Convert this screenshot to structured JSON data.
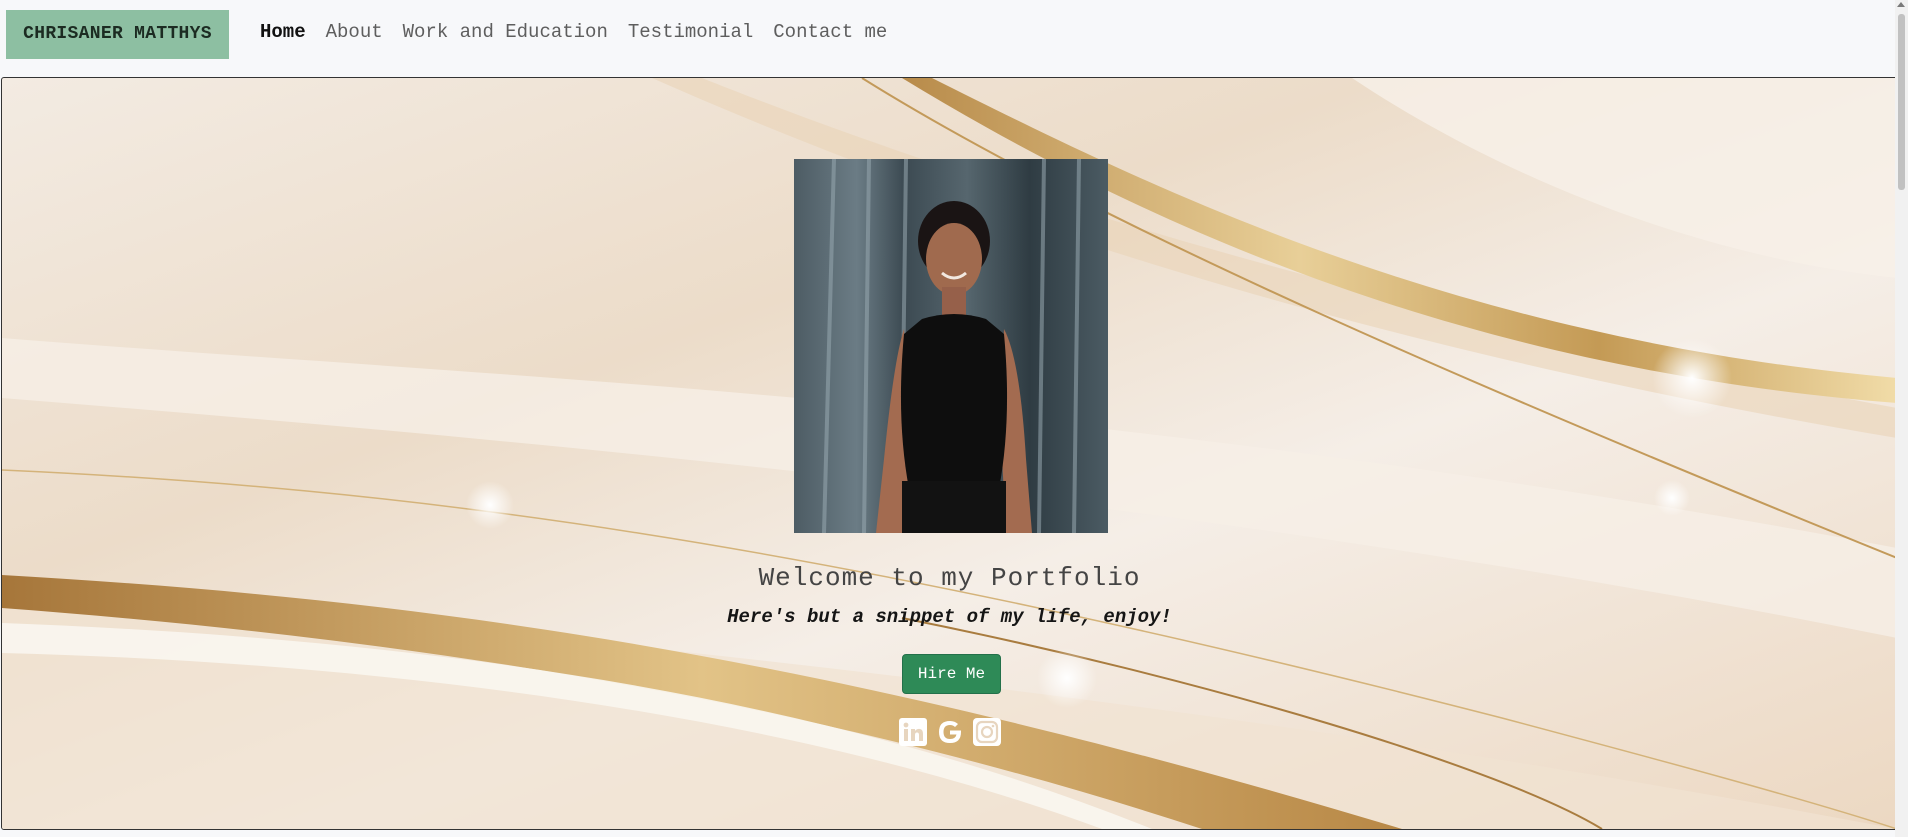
{
  "navbar": {
    "brand": "CHRISANER MATTHYS",
    "links": [
      {
        "label": "Home",
        "active": true
      },
      {
        "label": "About"
      },
      {
        "label": "Work and Education"
      },
      {
        "label": "Testimonial"
      },
      {
        "label": "Contact me"
      }
    ]
  },
  "hero": {
    "welcome": "Welcome to my Portfolio",
    "tagline": "Here's but a snippet of my life, enjoy!",
    "hire_label": "Hire Me",
    "socials": [
      "linkedin-icon",
      "google-icon",
      "instagram-icon"
    ]
  },
  "colors": {
    "brand_bg": "#8dbfa2",
    "button": "#2e8a57",
    "gold": "#c9a45f"
  }
}
